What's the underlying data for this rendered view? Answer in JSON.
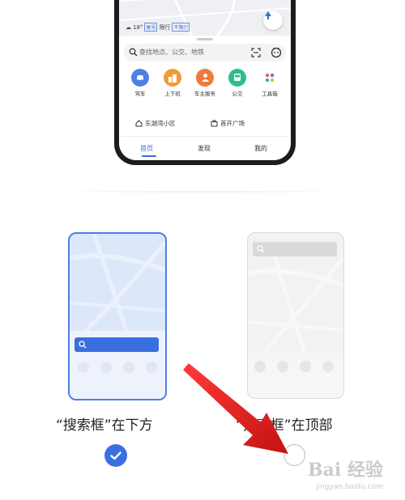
{
  "phone": {
    "weather": {
      "temp": "18°",
      "plate_badge": "尾号",
      "limit_text": "限行",
      "restriction": "不限行"
    },
    "search": {
      "placeholder": "查找地点、公交、地铁"
    },
    "tools": [
      {
        "label": "驾车",
        "icon": "car-icon",
        "color": "#4f7fe6"
      },
      {
        "label": "上下班",
        "icon": "commute-icon",
        "color": "#f09a3a"
      },
      {
        "label": "车主服务",
        "icon": "car-owner-icon",
        "color": "#f07a3a"
      },
      {
        "label": "公交",
        "icon": "bus-icon",
        "color": "#2bbf8a"
      },
      {
        "label": "工具箱",
        "icon": "toolbox-icon",
        "color": "#ffffff"
      }
    ],
    "places": [
      {
        "label": "东湖湾小区",
        "icon": "home-icon"
      },
      {
        "label": "首开广场",
        "icon": "briefcase-icon"
      }
    ],
    "tabs": [
      {
        "label": "首页",
        "active": true
      },
      {
        "label": "发现",
        "active": false
      },
      {
        "label": "我的",
        "active": false
      }
    ]
  },
  "options": [
    {
      "label": "“搜索框”在下方",
      "selected": true
    },
    {
      "label": "“搜索框”在顶部",
      "selected": false
    }
  ],
  "colors": {
    "accent": "#3a6fe0",
    "annotation_arrow": "#e52222"
  },
  "watermark": {
    "brand": "Bai 经验",
    "url": "jingyan.baidu.com"
  }
}
